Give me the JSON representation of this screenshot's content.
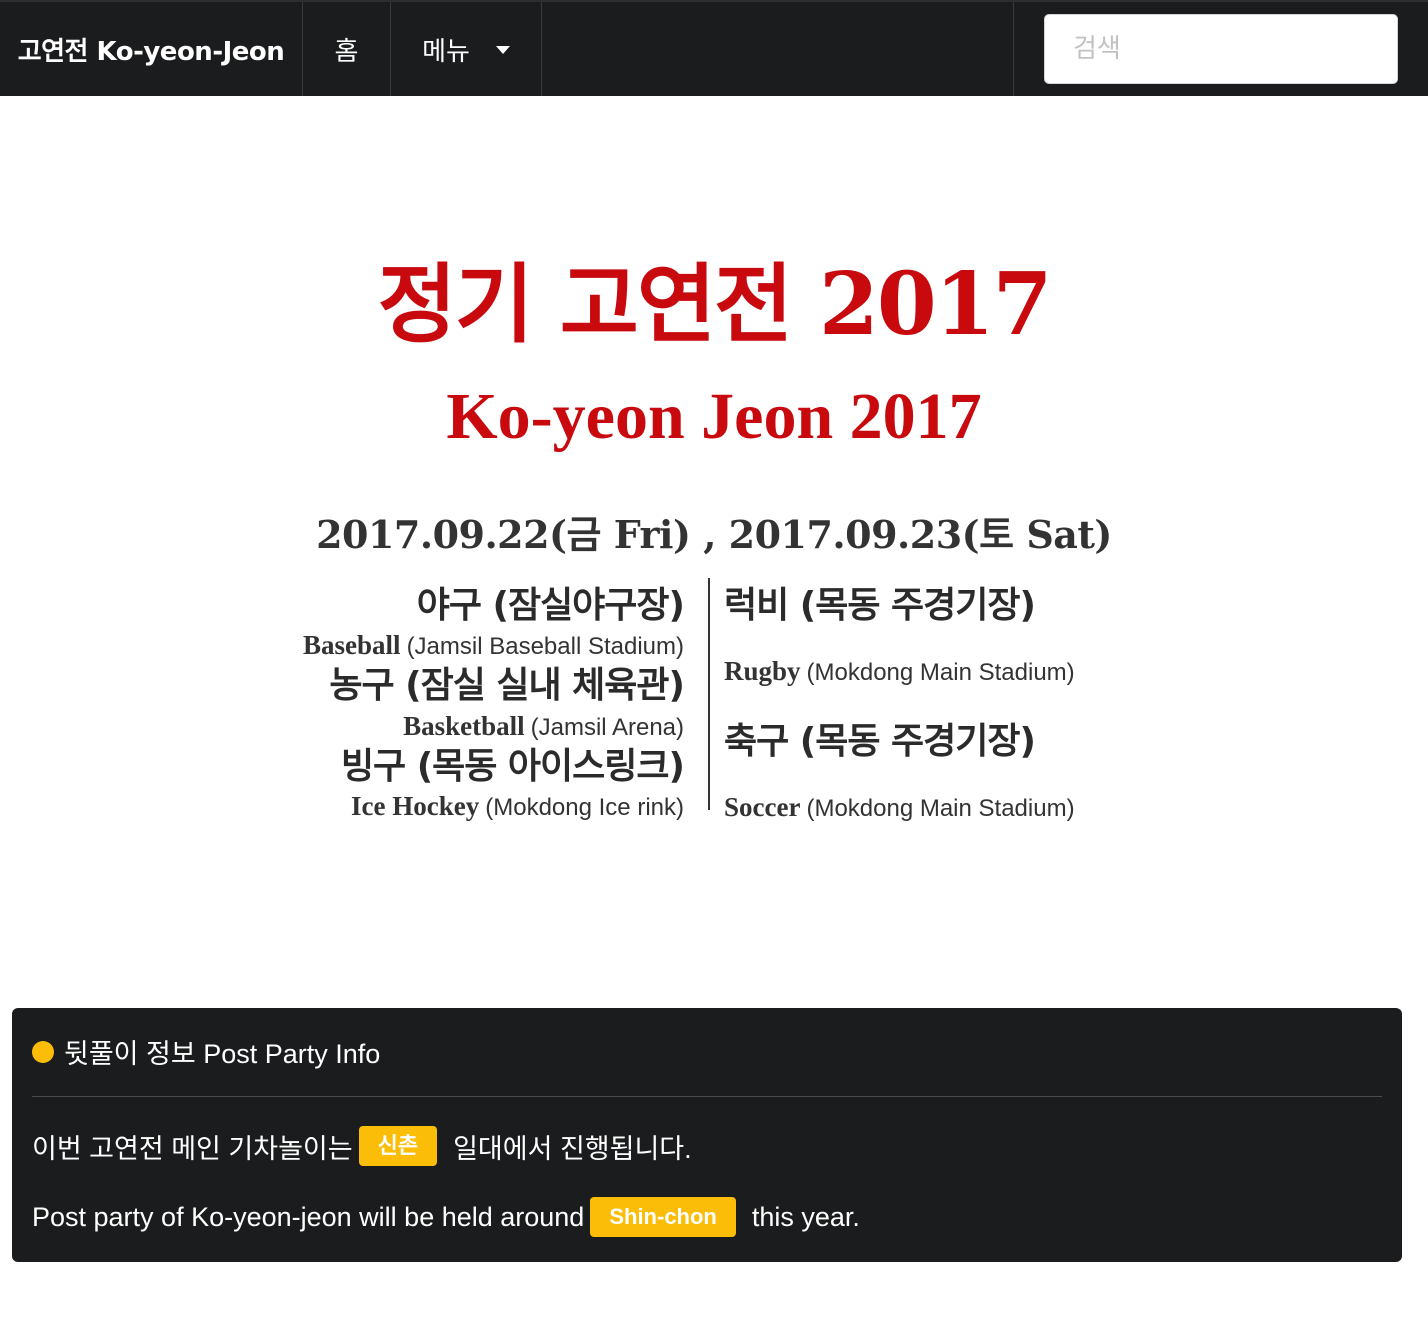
{
  "navbar": {
    "brand": "고연전 Ko-yeon-Jeon",
    "home": "홈",
    "menu": "메뉴",
    "search_placeholder": "검색"
  },
  "poster": {
    "title_ko": "정기 고연전 2017",
    "title_en": "Ko-yeon Jeon 2017",
    "dates": "2017.09.22(금 Fri) , 2017.09.23(토 Sat)",
    "day1": [
      {
        "ko": "야구 (잠실야구장)",
        "en_sport": "Baseball",
        "en_venue": "(Jamsil Baseball Stadium)"
      },
      {
        "ko": "농구 (잠실 실내 체육관)",
        "en_sport": "Basketball",
        "en_venue": "(Jamsil Arena)"
      },
      {
        "ko": "빙구 (목동 아이스링크)",
        "en_sport": "Ice Hockey",
        "en_venue": "(Mokdong Ice rink)"
      }
    ],
    "day2": [
      {
        "ko": "럭비 (목동 주경기장)",
        "en_sport": "Rugby",
        "en_venue": "(Mokdong Main Stadium)"
      },
      {
        "ko": "축구 (목동 주경기장)",
        "en_sport": "Soccer",
        "en_venue": "(Mokdong Main Stadium)"
      }
    ]
  },
  "info": {
    "header": "뒷풀이 정보 Post Party Info",
    "line1_before": "이번 고연전 메인 기차놀이는",
    "line1_label": "신촌",
    "line1_after": "일대에서 진행됩니다.",
    "line2_before": "Post party of Ko-yeon-jeon will be held around",
    "line2_label": "Shin-chon",
    "line2_after": "this year.",
    "accent_color": "#fbbd08"
  }
}
